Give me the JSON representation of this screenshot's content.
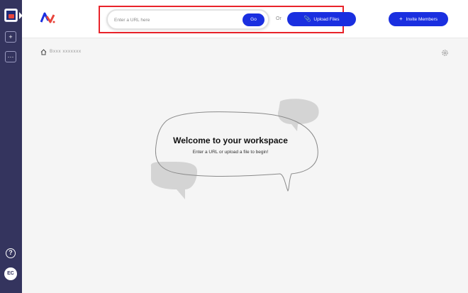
{
  "sidebar": {
    "add_label": "+",
    "more_label": "···",
    "help_label": "?",
    "avatar_initials": "EC"
  },
  "header": {
    "url_placeholder": "Enter a URL here",
    "go_label": "Go",
    "or_label": "Or",
    "upload_label": "Upload Files",
    "invite_label": "Invite Members"
  },
  "breadcrumb": {
    "label": "Bxxx xxxxxxx"
  },
  "main": {
    "welcome_title": "Welcome to your workspace",
    "welcome_subtitle": "Enter a URL or upload a file to begin!"
  },
  "colors": {
    "sidebar": "#34345e",
    "accent": "#1a2fe0",
    "highlight": "#e8232a",
    "background": "#f5f5f5"
  }
}
